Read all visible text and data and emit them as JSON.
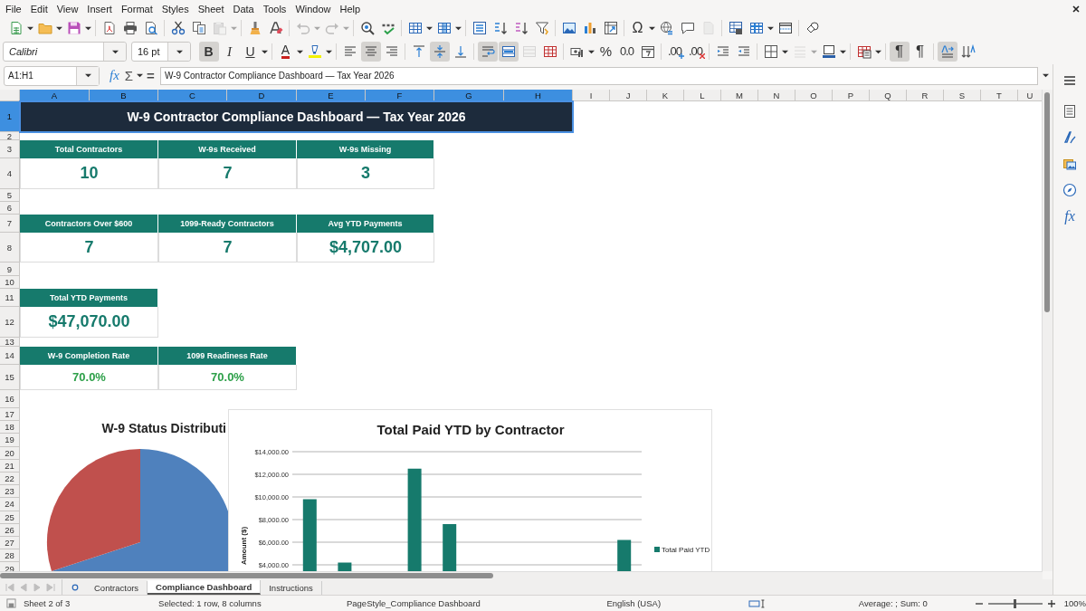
{
  "menu": [
    "File",
    "Edit",
    "View",
    "Insert",
    "Format",
    "Styles",
    "Sheet",
    "Data",
    "Tools",
    "Window",
    "Help"
  ],
  "standard_toolbar": [
    [
      {
        "kind": "new",
        "dropdown": true,
        "disabled": false
      },
      {
        "kind": "open",
        "dropdown": true,
        "disabled": false
      },
      {
        "kind": "save",
        "dropdown": true,
        "disabled": false
      }
    ],
    [
      {
        "kind": "pdf",
        "dropdown": false,
        "disabled": false
      },
      {
        "kind": "print",
        "dropdown": false,
        "disabled": false
      },
      {
        "kind": "preview",
        "dropdown": false,
        "disabled": false
      }
    ],
    [
      {
        "kind": "cut",
        "dropdown": false,
        "disabled": false
      },
      {
        "kind": "copy",
        "dropdown": false,
        "disabled": false
      },
      {
        "kind": "paste",
        "dropdown": true,
        "disabled": true
      }
    ],
    [
      {
        "kind": "clone",
        "dropdown": false,
        "disabled": false
      },
      {
        "kind": "clear",
        "dropdown": false,
        "disabled": false
      }
    ],
    [
      {
        "kind": "undo",
        "dropdown": true,
        "disabled": true
      },
      {
        "kind": "redo",
        "dropdown": true,
        "disabled": true
      }
    ],
    [
      {
        "kind": "find",
        "dropdown": false,
        "disabled": false
      },
      {
        "kind": "spell",
        "dropdown": false,
        "disabled": false
      }
    ],
    [
      {
        "kind": "row",
        "dropdown": true,
        "disabled": false
      },
      {
        "kind": "col",
        "dropdown": true,
        "disabled": false
      }
    ],
    [
      {
        "kind": "sort",
        "dropdown": false,
        "disabled": false
      },
      {
        "kind": "sort_asc",
        "dropdown": false,
        "disabled": false
      },
      {
        "kind": "sort_desc",
        "dropdown": false,
        "disabled": false
      },
      {
        "kind": "filter",
        "dropdown": false,
        "disabled": false
      }
    ],
    [
      {
        "kind": "image",
        "dropdown": false,
        "disabled": false
      },
      {
        "kind": "chart",
        "dropdown": false,
        "disabled": false
      },
      {
        "kind": "pivot",
        "dropdown": false,
        "disabled": false
      }
    ],
    [
      {
        "kind": "special",
        "label": "Ω",
        "dropdown": true,
        "disabled": false
      },
      {
        "kind": "link",
        "dropdown": false,
        "disabled": false
      },
      {
        "kind": "comment",
        "dropdown": false,
        "disabled": false
      },
      {
        "kind": "header",
        "dropdown": false,
        "disabled": true
      }
    ],
    [
      {
        "kind": "print_area",
        "dropdown": false,
        "disabled": false
      },
      {
        "kind": "freeze",
        "dropdown": true,
        "disabled": false
      },
      {
        "kind": "split",
        "dropdown": false,
        "disabled": false
      }
    ],
    [
      {
        "kind": "shapes",
        "dropdown": false,
        "disabled": false
      }
    ]
  ],
  "formatting_toolbar": {
    "font_name": "Calibri",
    "font_size": "16 pt",
    "groups": [
      [
        {
          "kind": "bold",
          "label": "B",
          "dropdown": false,
          "pressed": true,
          "disabled": false
        },
        {
          "kind": "italic",
          "label": "I",
          "dropdown": false,
          "pressed": false,
          "disabled": false
        },
        {
          "kind": "underline",
          "label": "U",
          "dropdown": true,
          "pressed": false,
          "disabled": false
        }
      ],
      [
        {
          "kind": "font_color",
          "label": "A",
          "dropdown": true,
          "pressed": false,
          "disabled": false
        },
        {
          "kind": "highlight",
          "dropdown": true,
          "pressed": false,
          "disabled": false
        }
      ],
      [
        {
          "kind": "align_left",
          "dropdown": false,
          "pressed": false,
          "disabled": false
        },
        {
          "kind": "align_center",
          "dropdown": false,
          "pressed": true,
          "disabled": false
        },
        {
          "kind": "align_right",
          "dropdown": false,
          "pressed": false,
          "disabled": false
        }
      ],
      [
        {
          "kind": "align_top",
          "dropdown": false,
          "pressed": false,
          "disabled": false
        },
        {
          "kind": "align_middle",
          "dropdown": false,
          "pressed": true,
          "disabled": false
        },
        {
          "kind": "align_bottom",
          "dropdown": false,
          "pressed": false,
          "disabled": false
        }
      ],
      [
        {
          "kind": "wrap",
          "dropdown": false,
          "pressed": true,
          "disabled": false
        },
        {
          "kind": "merge_center",
          "dropdown": false,
          "pressed": true,
          "disabled": false
        },
        {
          "kind": "merge",
          "dropdown": false,
          "pressed": false,
          "disabled": true
        },
        {
          "kind": "unmerge",
          "dropdown": false,
          "pressed": false,
          "disabled": false
        }
      ],
      [
        {
          "kind": "currency",
          "dropdown": true,
          "pressed": false,
          "disabled": false
        },
        {
          "kind": "percent",
          "label": "%",
          "dropdown": false,
          "pressed": false,
          "disabled": false
        },
        {
          "kind": "number",
          "label": "0.0",
          "dropdown": false,
          "pressed": false,
          "disabled": false
        },
        {
          "kind": "date",
          "dropdown": false,
          "pressed": false,
          "disabled": false
        }
      ],
      [
        {
          "kind": "add_decimal",
          "label": ".00",
          "dropdown": false,
          "pressed": false,
          "disabled": false
        },
        {
          "kind": "delete_decimal",
          "label": ".00",
          "dropdown": false,
          "pressed": false,
          "disabled": false
        }
      ],
      [
        {
          "kind": "indent",
          "dropdown": false,
          "pressed": false,
          "disabled": false
        },
        {
          "kind": "outdent",
          "dropdown": false,
          "pressed": false,
          "disabled": false
        }
      ],
      [
        {
          "kind": "borders",
          "dropdown": true,
          "pressed": false,
          "disabled": false
        },
        {
          "kind": "border_style",
          "dropdown": true,
          "pressed": false,
          "disabled": true
        },
        {
          "kind": "border_color",
          "dropdown": true,
          "pressed": false,
          "disabled": false
        }
      ],
      [
        {
          "kind": "conditional",
          "dropdown": true,
          "pressed": false,
          "disabled": false
        }
      ],
      [
        {
          "kind": "ltr",
          "label": "¶",
          "dropdown": false,
          "pressed": true,
          "disabled": false
        },
        {
          "kind": "rtl",
          "label": "¶",
          "dropdown": false,
          "pressed": false,
          "disabled": false
        }
      ],
      [
        {
          "kind": "text_direction",
          "dropdown": false,
          "pressed": true,
          "disabled": false
        },
        {
          "kind": "vertical_text",
          "dropdown": false,
          "pressed": false,
          "disabled": false
        }
      ]
    ]
  },
  "formula_bar": {
    "name_box": "A1:H1",
    "function_wizard": "fx",
    "sum": "Σ",
    "equals": "=",
    "formula": "W-9 Contractor Compliance Dashboard — Tax Year 2026"
  },
  "sheet": {
    "columns": [
      {
        "label": "A",
        "selected": true
      },
      {
        "label": "B",
        "selected": true
      },
      {
        "label": "C",
        "selected": true
      },
      {
        "label": "D",
        "selected": true
      },
      {
        "label": "E",
        "selected": true
      },
      {
        "label": "F",
        "selected": true
      },
      {
        "label": "G",
        "selected": true
      },
      {
        "label": "H",
        "selected": true
      },
      {
        "label": "I",
        "selected": false
      },
      {
        "label": "J",
        "selected": false
      },
      {
        "label": "K",
        "selected": false
      },
      {
        "label": "L",
        "selected": false
      },
      {
        "label": "M",
        "selected": false
      },
      {
        "label": "N",
        "selected": false
      },
      {
        "label": "O",
        "selected": false
      },
      {
        "label": "P",
        "selected": false
      },
      {
        "label": "Q",
        "selected": false
      },
      {
        "label": "R",
        "selected": false
      },
      {
        "label": "S",
        "selected": false
      },
      {
        "label": "T",
        "selected": false
      },
      {
        "label": "U",
        "selected": false
      }
    ],
    "rows": [
      {
        "label": "1",
        "selected": true
      },
      {
        "label": "2",
        "selected": false
      },
      {
        "label": "3",
        "selected": false
      },
      {
        "label": "4",
        "selected": false
      },
      {
        "label": "5",
        "selected": false
      },
      {
        "label": "6",
        "selected": false
      },
      {
        "label": "7",
        "selected": false
      },
      {
        "label": "8",
        "selected": false
      },
      {
        "label": "9",
        "selected": false
      },
      {
        "label": "10",
        "selected": false
      },
      {
        "label": "11",
        "selected": false
      },
      {
        "label": "12",
        "selected": false
      },
      {
        "label": "13",
        "selected": false
      },
      {
        "label": "14",
        "selected": false
      },
      {
        "label": "15",
        "selected": false
      },
      {
        "label": "16",
        "selected": false
      },
      {
        "label": "17",
        "selected": false
      },
      {
        "label": "18",
        "selected": false
      },
      {
        "label": "19",
        "selected": false
      },
      {
        "label": "20",
        "selected": false
      },
      {
        "label": "21",
        "selected": false
      },
      {
        "label": "22",
        "selected": false
      },
      {
        "label": "23",
        "selected": false
      },
      {
        "label": "24",
        "selected": false
      },
      {
        "label": "25",
        "selected": false
      },
      {
        "label": "26",
        "selected": false
      },
      {
        "label": "27",
        "selected": false
      },
      {
        "label": "28",
        "selected": false
      },
      {
        "label": "29",
        "selected": false
      }
    ],
    "title": "W-9 Contractor Compliance Dashboard — Tax Year 2026",
    "title_selected": true,
    "metric_groups": [
      [
        {
          "label": "Total Contractors",
          "value": "10",
          "kind": "metric"
        },
        {
          "label": "W-9s Received",
          "value": "7",
          "kind": "metric"
        },
        {
          "label": "W-9s Missing",
          "value": "3",
          "kind": "metric"
        }
      ],
      [
        {
          "label": "Contractors Over $600",
          "value": "7",
          "kind": "metric"
        },
        {
          "label": "1099-Ready Contractors",
          "value": "7",
          "kind": "metric"
        },
        {
          "label": "Avg YTD Payments",
          "value": "$4,707.00",
          "kind": "metric"
        }
      ],
      [
        {
          "label": "Total YTD Payments",
          "value": "$47,070.00",
          "kind": "metric"
        }
      ],
      [
        {
          "label": "W-9 Completion Rate",
          "value": "70.0%",
          "kind": "rate"
        },
        {
          "label": "1099 Readiness Rate",
          "value": "70.0%",
          "kind": "rate"
        }
      ]
    ]
  },
  "pie_chart": {
    "title": "W-9 Status Distributi"
  },
  "bar_chart": {
    "chart_data": {
      "type": "bar",
      "title": "Total Paid YTD by Contractor",
      "ylabel": "Amount ($)",
      "series": [
        {
          "name": "Total Paid YTD",
          "color": "#167a6c",
          "values": [
            9800,
            4200,
            null,
            12500,
            7600,
            null,
            null,
            null,
            null,
            6200
          ]
        }
      ],
      "ylim": [
        0,
        14000
      ],
      "grid": true,
      "yticks": [
        {
          "value": 4000,
          "label": "$4,000.00"
        },
        {
          "value": 6000,
          "label": "$6,000.00"
        },
        {
          "value": 8000,
          "label": "$8,000.00"
        },
        {
          "value": 10000,
          "label": "$10,000.00"
        },
        {
          "value": 12000,
          "label": "$12,000.00"
        },
        {
          "value": 14000,
          "label": "$14,000.00"
        }
      ]
    }
  },
  "sidebar": [
    {
      "kind": "menu"
    },
    {
      "kind": "properties"
    },
    {
      "kind": "styles"
    },
    {
      "kind": "gallery"
    },
    {
      "kind": "navigator"
    },
    {
      "kind": "functions",
      "label": "fx"
    }
  ],
  "sheet_tabs": [
    {
      "label": "Contractors",
      "selected": false
    },
    {
      "label": "Compliance Dashboard",
      "selected": true
    },
    {
      "label": "Instructions",
      "selected": false
    }
  ],
  "status_bar": {
    "sheet": "Sheet 2 of 3",
    "selection": "Selected: 1 row, 8 columns",
    "page_style": "PageStyle_Compliance Dashboard",
    "language": "English (USA)",
    "summary": "Average: ; Sum: 0",
    "zoom": {
      "level": 0.5,
      "reading": "100%"
    }
  }
}
